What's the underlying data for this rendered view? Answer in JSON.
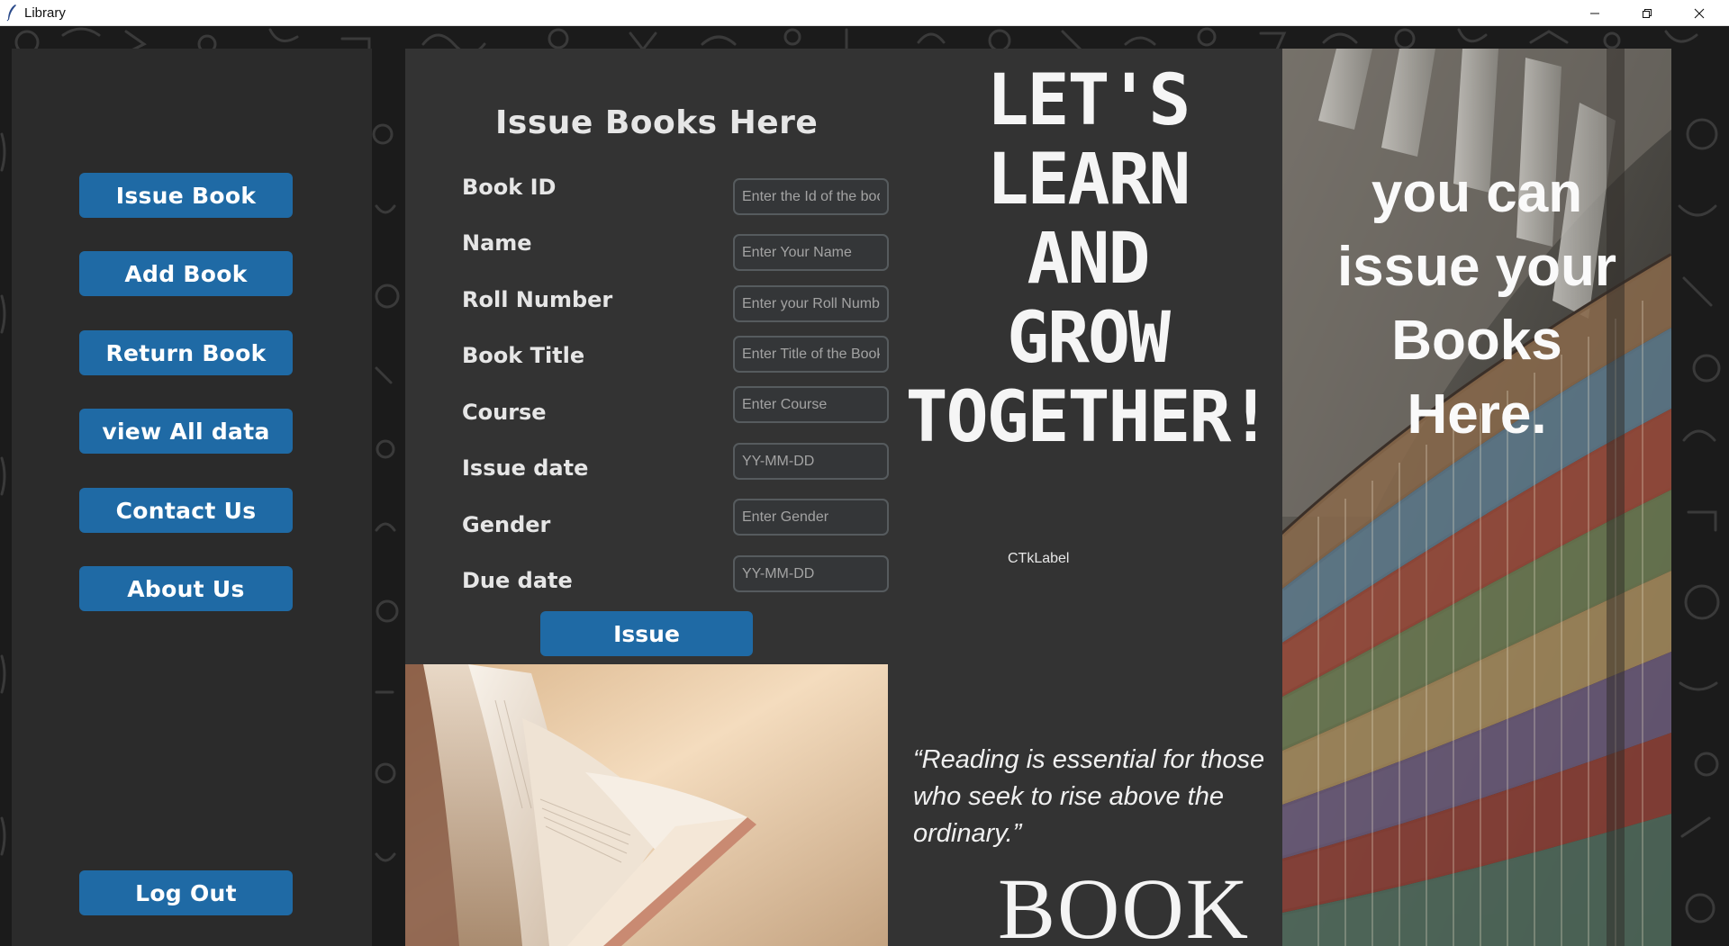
{
  "window": {
    "title": "Library",
    "icon": "feather-icon",
    "controls": [
      "minimize-icon",
      "restore-icon",
      "close-icon"
    ]
  },
  "sidebar": {
    "items": [
      {
        "label": "Issue Book"
      },
      {
        "label": "Add Book"
      },
      {
        "label": "Return Book"
      },
      {
        "label": "view All data"
      },
      {
        "label": "Contact Us"
      },
      {
        "label": "About Us"
      }
    ],
    "logout_label": "Log Out"
  },
  "form": {
    "title": "Issue Books Here",
    "fields": [
      {
        "label": "Book ID",
        "placeholder": "Enter the Id of the book",
        "value": ""
      },
      {
        "label": "Name",
        "placeholder": "Enter Your Name",
        "value": ""
      },
      {
        "label": "Roll Number",
        "placeholder": "Enter your Roll Number",
        "value": ""
      },
      {
        "label": "Book Title",
        "placeholder": "Enter Title of the Book",
        "value": ""
      },
      {
        "label": "Course",
        "placeholder": "Enter Course",
        "value": ""
      },
      {
        "label": "Issue date",
        "placeholder": "YY-MM-DD",
        "value": ""
      },
      {
        "label": "Gender",
        "placeholder": "Enter Gender",
        "value": ""
      },
      {
        "label": "Due date",
        "placeholder": "YY-MM-DD",
        "value": ""
      }
    ],
    "submit_label": "Issue"
  },
  "slogan": {
    "lines": [
      "LET'S",
      "LEARN",
      "AND",
      "GROW",
      "TOGETHER!"
    ]
  },
  "ctk_label": "CTkLabel",
  "quote": {
    "text": "“Reading is essential for those who seek to rise above the ordinary.”",
    "big_word": "BOOK"
  },
  "library_panel": {
    "lines": [
      "you can",
      "issue your",
      "Books",
      "Here."
    ]
  },
  "colors": {
    "accent": "#1f6aa5",
    "sidebar_bg": "#2b2b2b",
    "main_bg": "#333333",
    "input_border": "#565b5e",
    "text": "#e6e6e6"
  }
}
